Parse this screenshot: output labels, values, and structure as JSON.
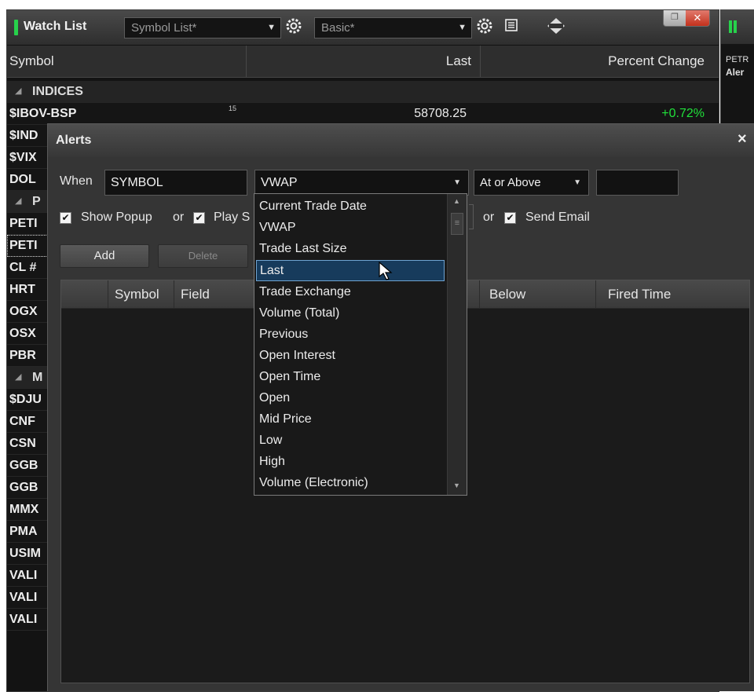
{
  "watchlist": {
    "title": "Watch List",
    "symbol_list": "Symbol List*",
    "view": "Basic*",
    "columns": [
      "Symbol",
      "Last",
      "Percent Change"
    ],
    "groups": {
      "indices": "INDICES",
      "p": "P",
      "m": "M"
    },
    "rows": [
      {
        "symbol": "$IBOV-BSP",
        "badge": "15",
        "last": "58708.25",
        "change": "+0.72%"
      },
      {
        "symbol": "$IND"
      },
      {
        "symbol": "$VIX"
      },
      {
        "symbol": "DOL"
      },
      {
        "symbol": "PETI"
      },
      {
        "symbol": "PETI"
      },
      {
        "symbol": "CL #"
      },
      {
        "symbol": "HRT"
      },
      {
        "symbol": "OGX"
      },
      {
        "symbol": "OSX"
      },
      {
        "symbol": "PBR"
      },
      {
        "symbol": "$DJU"
      },
      {
        "symbol": "CNF"
      },
      {
        "symbol": "CSN"
      },
      {
        "symbol": "GGB"
      },
      {
        "symbol": "GGB"
      },
      {
        "symbol": "MMX"
      },
      {
        "symbol": "PMA"
      },
      {
        "symbol": "USIM"
      },
      {
        "symbol": "VALI"
      },
      {
        "symbol": "VALI"
      },
      {
        "symbol": "VALI"
      }
    ],
    "colors": {
      "positive": "#20e03a",
      "accent": "#27d14b"
    }
  },
  "right_panel": {
    "line1": "PETR",
    "line2": "Aler"
  },
  "alerts": {
    "title": "Alerts",
    "close": "×",
    "when_label": "When",
    "symbol_value": "SYMBOL",
    "field_value": "VWAP",
    "condition_value": "At or Above",
    "threshold_value": "",
    "show_popup": "Show Popup",
    "or1": "or",
    "play_sound": "Play S",
    "or2": "or",
    "send_email": "Send Email",
    "add": "Add",
    "delete": "Delete",
    "grid_columns": [
      "Symbol",
      "Field",
      "Below",
      "Fired Time"
    ]
  },
  "dropdown": {
    "items": [
      "Current Trade Date",
      "VWAP",
      "Trade Last Size",
      "Last",
      "Trade Exchange",
      "Volume (Total)",
      "Previous",
      "Open Interest",
      "Open Time",
      "Open",
      "Mid Price",
      "Low",
      "High",
      "Volume (Electronic)"
    ],
    "selected": "Last"
  },
  "icons": {
    "gear": "gear-icon",
    "table": "table-icon",
    "sort": "sort-icon"
  }
}
